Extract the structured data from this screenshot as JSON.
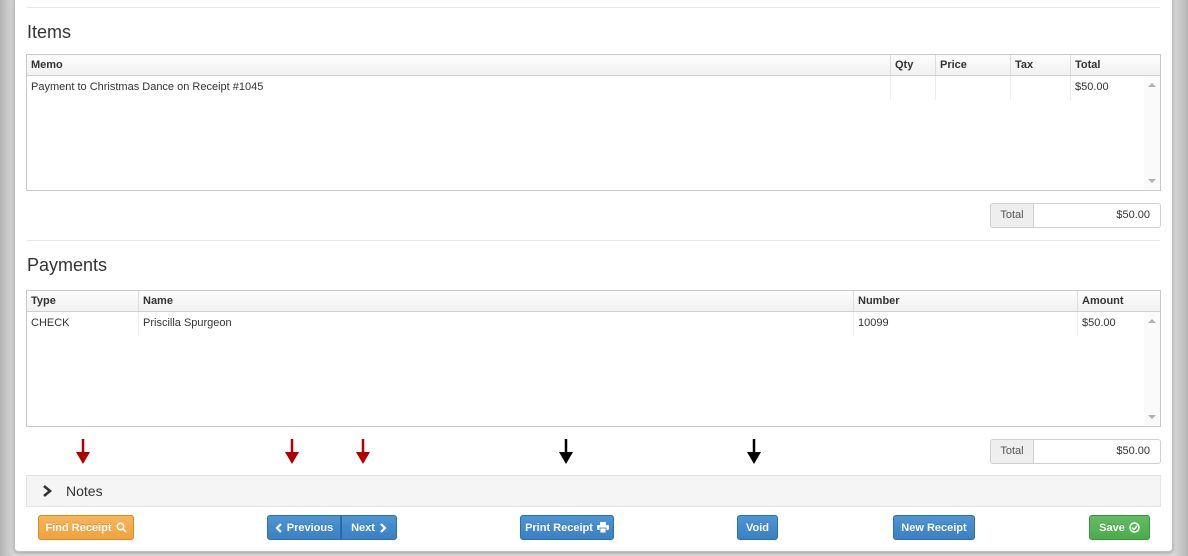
{
  "items": {
    "title": "Items",
    "columns": [
      "Memo",
      "Qty",
      "Price",
      "Tax",
      "Total"
    ],
    "rows": [
      {
        "memo": "Payment to Christmas Dance on Receipt #1045",
        "qty": "",
        "price": "",
        "tax": "",
        "total": "$50.00"
      }
    ],
    "total_label": "Total",
    "total_value": "$50.00"
  },
  "payments": {
    "title": "Payments",
    "columns": [
      "Type",
      "Name",
      "Number",
      "Amount"
    ],
    "rows": [
      {
        "type": "CHECK",
        "name": "Priscilla Spurgeon",
        "number": "10099",
        "amount": "$50.00"
      }
    ],
    "total_label": "Total",
    "total_value": "$50.00"
  },
  "notes": {
    "label": "Notes"
  },
  "buttons": {
    "find_receipt": "Find Receipt",
    "previous": "Previous",
    "next": "Next",
    "print_receipt": "Print Receipt",
    "void": "Void",
    "new_receipt": "New Receipt",
    "save": "Save"
  },
  "colors": {
    "arrow_red": "#b00000",
    "arrow_black": "#000000",
    "button_blue": "#3a80c4",
    "button_orange": "#f0a23c",
    "button_green": "#4cab4c"
  },
  "icons": {
    "find": "search-icon",
    "previous": "chevron-left-icon",
    "next": "chevron-right-icon",
    "print": "printer-icon",
    "save": "check-circle-icon",
    "notes": "chevron-right-icon"
  }
}
